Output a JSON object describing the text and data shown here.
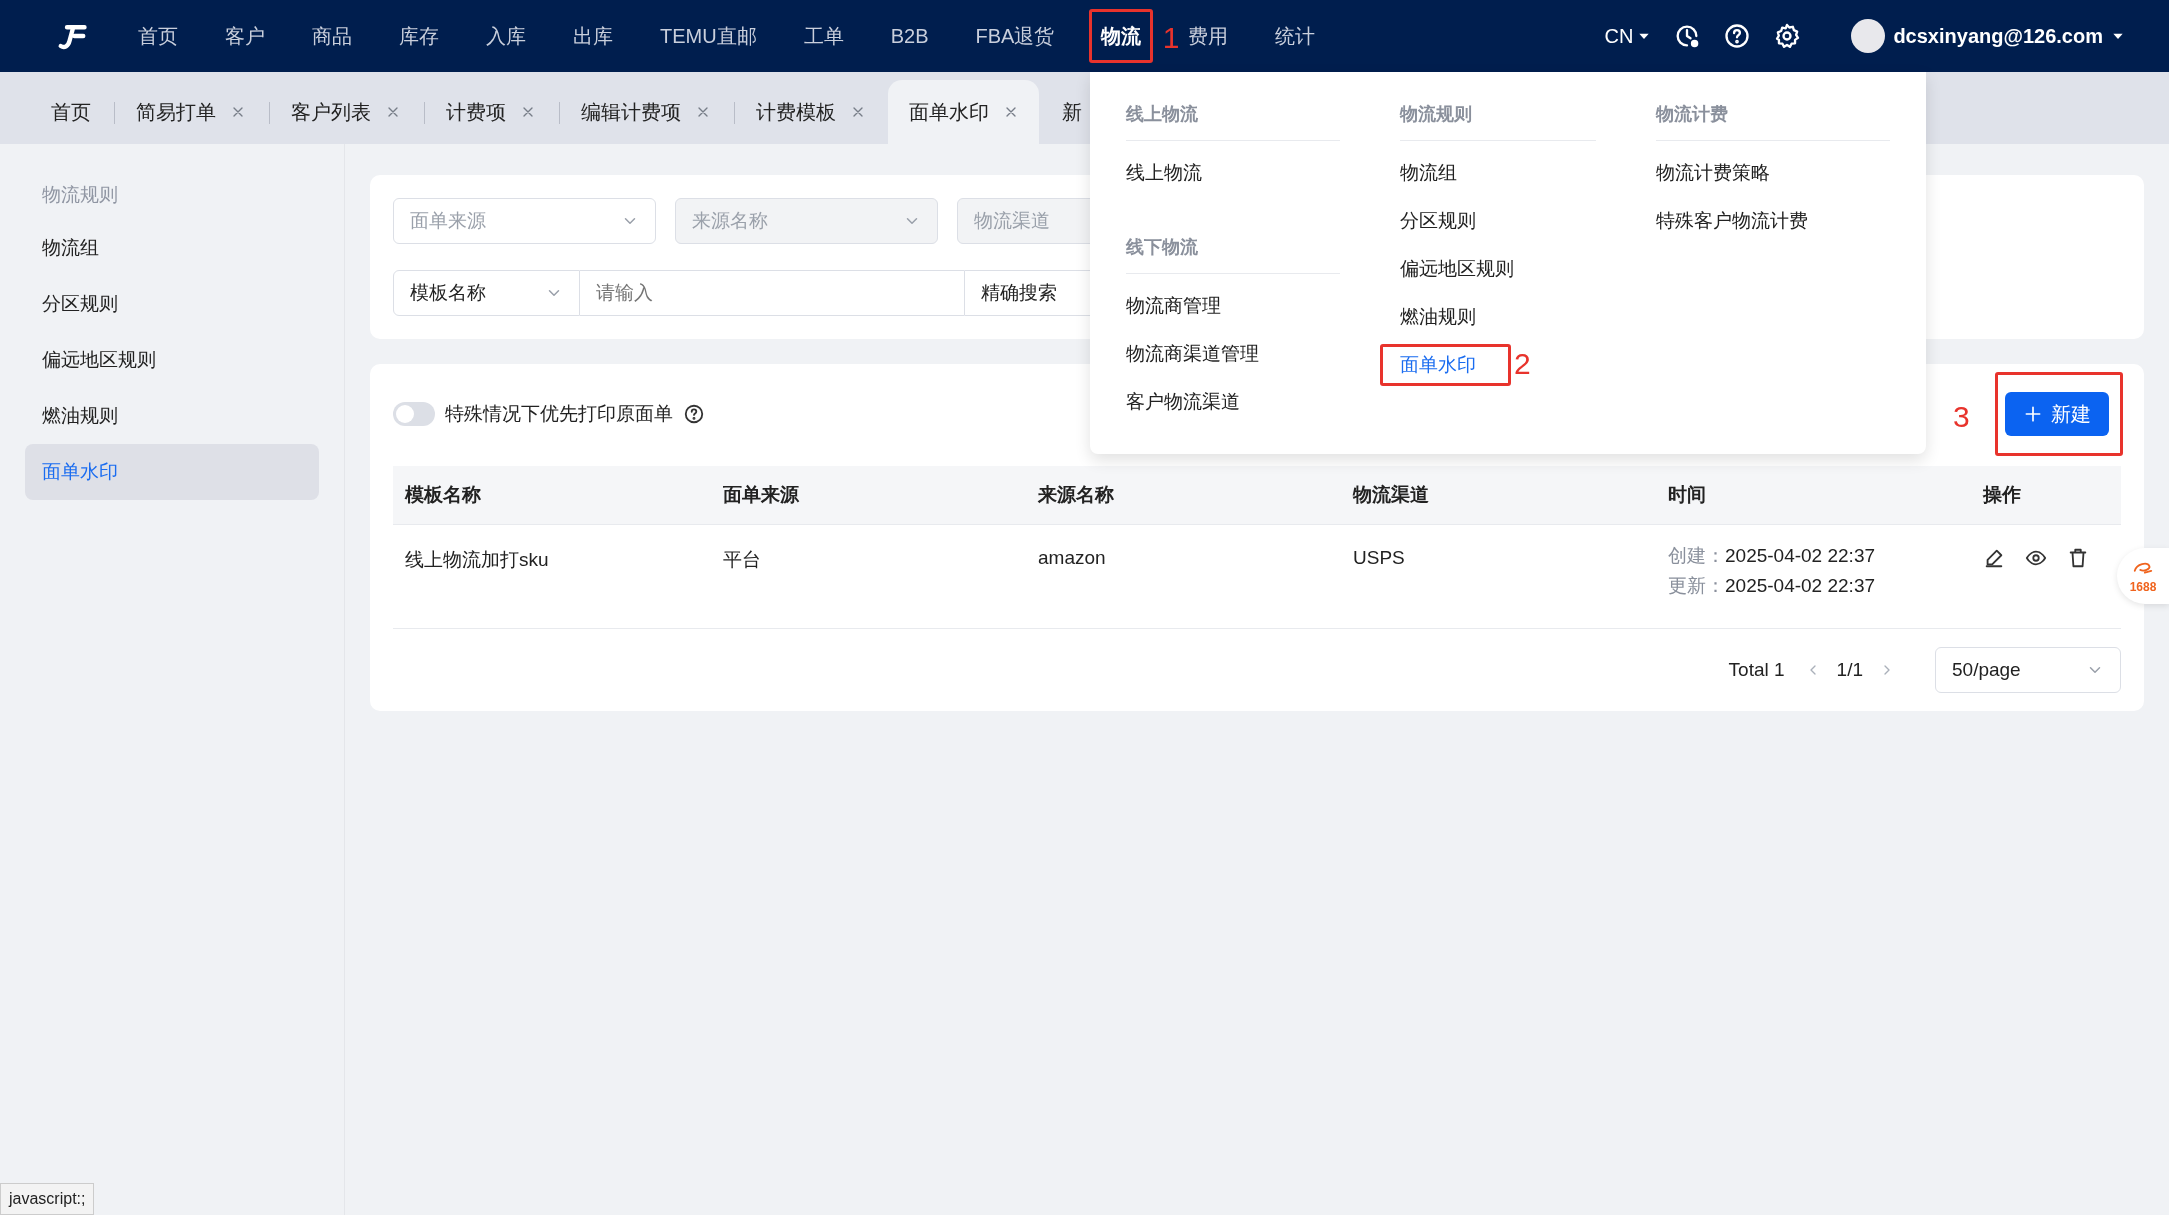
{
  "top_nav": {
    "items": [
      {
        "label": "首页",
        "selected": false
      },
      {
        "label": "客户",
        "selected": false
      },
      {
        "label": "商品",
        "selected": false
      },
      {
        "label": "库存",
        "selected": false
      },
      {
        "label": "入库",
        "selected": false
      },
      {
        "label": "出库",
        "selected": false
      },
      {
        "label": "TEMU直邮",
        "selected": false
      },
      {
        "label": "工单",
        "selected": false
      },
      {
        "label": "B2B",
        "selected": false
      },
      {
        "label": "FBA退货",
        "selected": false
      },
      {
        "label": "物流",
        "selected": true,
        "annotation": "1"
      },
      {
        "label": "费用",
        "selected": false
      },
      {
        "label": "统计",
        "selected": false
      }
    ],
    "language": "CN",
    "user": "dcsxinyang@126.com"
  },
  "tabs": [
    {
      "label": "首页",
      "selected": false,
      "closable": false
    },
    {
      "label": "简易打单",
      "selected": false,
      "closable": true
    },
    {
      "label": "客户列表",
      "selected": false,
      "closable": true
    },
    {
      "label": "计费项",
      "selected": false,
      "closable": true
    },
    {
      "label": "编辑计费项",
      "selected": false,
      "closable": true
    },
    {
      "label": "计费模板",
      "selected": false,
      "closable": true
    },
    {
      "label": "面单水印",
      "selected": true,
      "closable": true
    },
    {
      "label": "新",
      "selected": false,
      "closable": false
    }
  ],
  "sidebar": {
    "title": "物流规则",
    "items": [
      {
        "label": "物流组",
        "selected": false
      },
      {
        "label": "分区规则",
        "selected": false
      },
      {
        "label": "偏远地区规则",
        "selected": false
      },
      {
        "label": "燃油规则",
        "selected": false
      },
      {
        "label": "面单水印",
        "selected": true
      }
    ]
  },
  "filters": {
    "row1": [
      {
        "placeholder": "面单来源",
        "disabled": false
      },
      {
        "placeholder": "来源名称",
        "disabled": true
      },
      {
        "placeholder": "物流渠道",
        "disabled": true
      }
    ],
    "search_type": "模板名称",
    "search": {
      "placeholder": "请输入"
    },
    "match_mode": "精确搜索"
  },
  "toggle": {
    "label": "特殊情况下优先打印原面单",
    "on": false
  },
  "new_button": {
    "label": "新建",
    "annotation": "3"
  },
  "table": {
    "columns": [
      "模板名称",
      "面单来源",
      "来源名称",
      "物流渠道",
      "时间",
      "操作"
    ],
    "rows": [
      {
        "cells": [
          "线上物流加打sku",
          "平台",
          "amazon",
          "USPS"
        ],
        "created_label": "创建：",
        "created": "2025-04-02 22:37",
        "updated_label": "更新：",
        "updated": "2025-04-02 22:37"
      }
    ]
  },
  "pagination": {
    "total": "Total 1",
    "page": "1/1",
    "page_size": "50/page"
  },
  "dropdown": {
    "columns": [
      {
        "groups": [
          {
            "title": "线上物流",
            "items": [
              {
                "label": "线上物流",
                "selected": false
              }
            ]
          },
          {
            "title": "线下物流",
            "items": [
              {
                "label": "物流商管理",
                "selected": false
              },
              {
                "label": "物流商渠道管理",
                "selected": false
              },
              {
                "label": "客户物流渠道",
                "selected": false
              }
            ]
          }
        ]
      },
      {
        "groups": [
          {
            "title": "物流规则",
            "items": [
              {
                "label": "物流组",
                "selected": false
              },
              {
                "label": "分区规则",
                "selected": false
              },
              {
                "label": "偏远地区规则",
                "selected": false
              },
              {
                "label": "燃油规则",
                "selected": false
              },
              {
                "label": "面单水印",
                "selected": true,
                "annotation": "2"
              }
            ]
          }
        ]
      },
      {
        "groups": [
          {
            "title": "物流计费",
            "items": [
              {
                "label": "物流计费策略",
                "selected": false
              },
              {
                "label": "特殊客户物流计费",
                "selected": false
              }
            ]
          }
        ]
      }
    ]
  },
  "side_badge": "1688",
  "status_url": "javascript:;"
}
